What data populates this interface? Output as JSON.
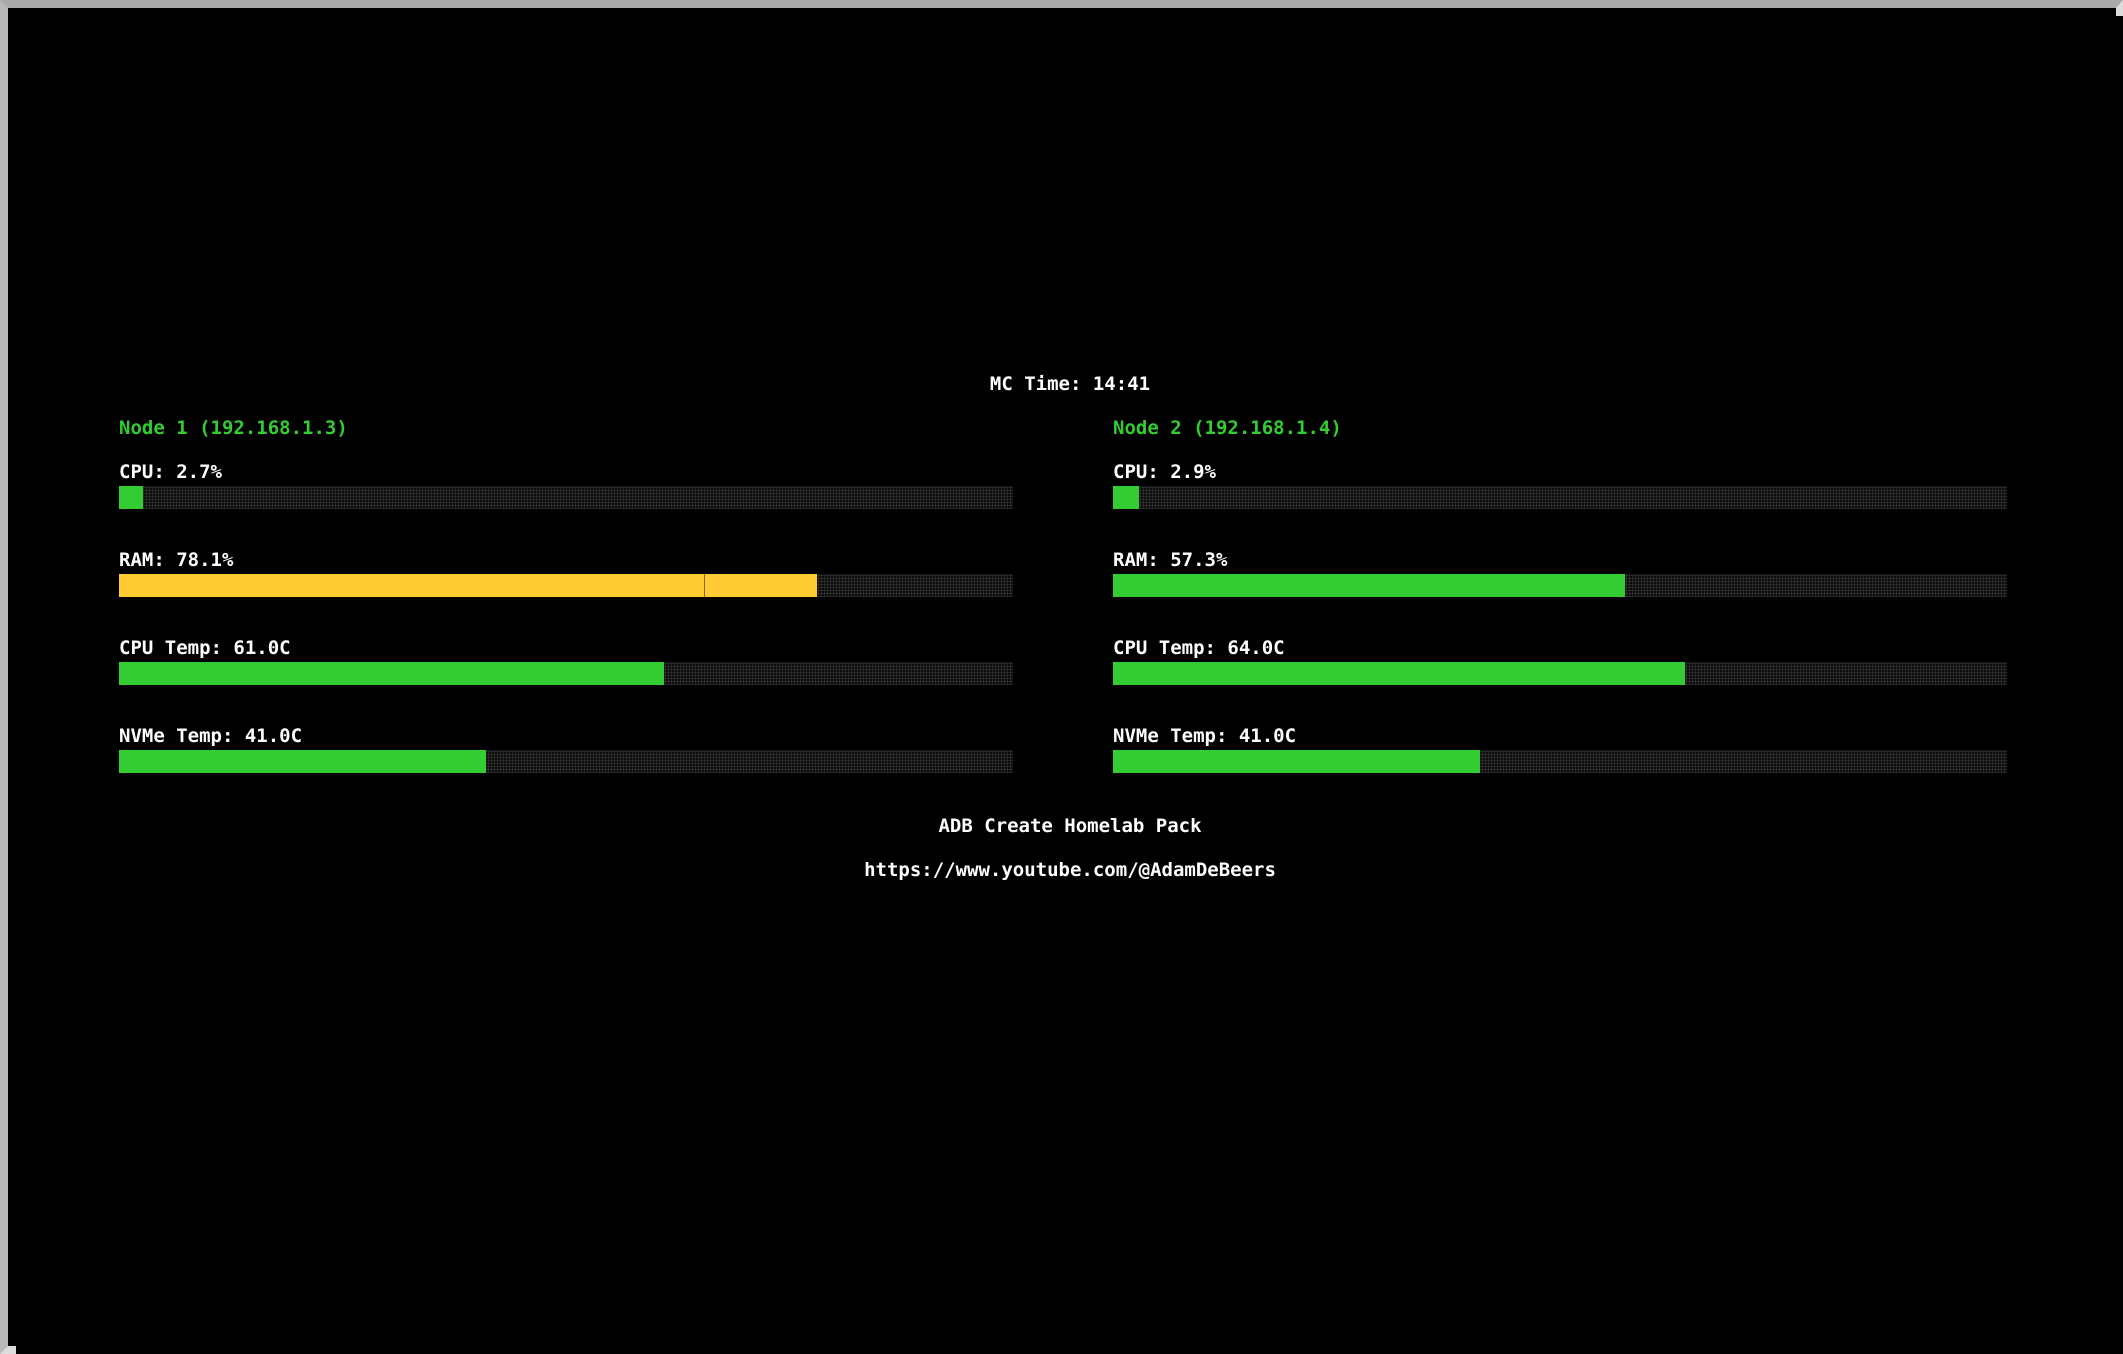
{
  "clock": "MC Time: 14:41",
  "colors": {
    "ok": "#33cc33",
    "warn": "#ffcc33",
    "text": "#ffffff",
    "background": "#000000"
  },
  "nodes": [
    {
      "title": "Node 1 (192.168.1.3)",
      "metrics": [
        {
          "label": "CPU: 2.7%",
          "fill": 0.027,
          "status": "ok"
        },
        {
          "label": "RAM: 78.1%",
          "fill": 0.781,
          "status": "warn"
        },
        {
          "label": "CPU Temp: 61.0C",
          "fill": 0.61,
          "status": "ok"
        },
        {
          "label": "NVMe Temp: 41.0C",
          "fill": 0.41,
          "status": "ok"
        }
      ]
    },
    {
      "title": "Node 2 (192.168.1.4)",
      "metrics": [
        {
          "label": "CPU: 2.9%",
          "fill": 0.029,
          "status": "ok"
        },
        {
          "label": "RAM: 57.3%",
          "fill": 0.573,
          "status": "ok"
        },
        {
          "label": "CPU Temp: 64.0C",
          "fill": 0.64,
          "status": "ok"
        },
        {
          "label": "NVMe Temp: 41.0C",
          "fill": 0.41,
          "status": "ok"
        }
      ]
    }
  ],
  "footer": {
    "title": "ADB Create Homelab Pack",
    "url": "https://www.youtube.com/@AdamDeBeers"
  }
}
